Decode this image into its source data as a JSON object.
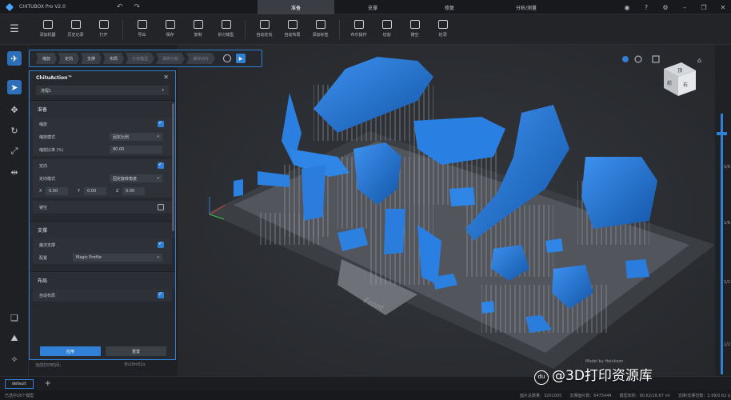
{
  "app": {
    "title": "CHITUBOX Pro V2.0"
  },
  "top_tabs": [
    {
      "label": "准备",
      "active": true
    },
    {
      "label": "支撑",
      "active": false
    },
    {
      "label": "修复",
      "active": false
    },
    {
      "label": "分析/测量",
      "active": false
    }
  ],
  "toolbar": {
    "items": [
      {
        "label": "添加机器",
        "icon": "add-machine-icon"
      },
      {
        "label": "历史记录",
        "icon": "history-icon"
      },
      {
        "label": "打开",
        "icon": "folder-open-icon"
      },
      {
        "label": "导出",
        "icon": "export-icon"
      },
      {
        "label": "保存",
        "icon": "save-icon"
      },
      {
        "label": "复制",
        "icon": "copy-icon"
      },
      {
        "label": "拆分模型",
        "icon": "split-model-icon"
      },
      {
        "label": "自动定向",
        "icon": "auto-orient-icon"
      },
      {
        "label": "自动布局",
        "icon": "auto-layout-icon"
      },
      {
        "label": "添加标签",
        "icon": "add-tag-icon"
      },
      {
        "label": "布尔操作",
        "icon": "boolean-icon"
      },
      {
        "label": "切割",
        "icon": "cut-icon"
      },
      {
        "label": "镂空",
        "icon": "hollow-icon"
      },
      {
        "label": "挖洞",
        "icon": "drill-hole-icon"
      }
    ]
  },
  "workflow": {
    "steps": [
      {
        "label": "缩放",
        "dim": false
      },
      {
        "label": "定向",
        "dim": false
      },
      {
        "label": "支撑",
        "dim": false
      },
      {
        "label": "布局",
        "dim": false
      },
      {
        "label": "分组模型",
        "dim": true
      },
      {
        "label": "保存分割",
        "dim": true
      },
      {
        "label": "保存切片",
        "dim": true
      }
    ]
  },
  "panel": {
    "title": "ChituAction™",
    "preset": "流程1",
    "sections": {
      "prepare": {
        "title": "准备",
        "scale_label": "缩放",
        "scale_mode_label": "缩放模式",
        "scale_mode_value": "固定比例",
        "scale_ratio_label": "缩放比率 (%)",
        "scale_ratio_value": "80.00",
        "orient_label": "定向",
        "orient_mode_label": "定向模式",
        "orient_mode_value": "固定旋转角度",
        "x_label": "X",
        "x_value": "0.00",
        "y_label": "Y",
        "y_value": "0.00",
        "z_label": "Z",
        "z_value": "0.00",
        "hollow_label": "镂空"
      },
      "support": {
        "title": "支撑",
        "magic_support_label": "魔法支撑",
        "config_label": "配置",
        "config_value": "Magic Profile"
      },
      "layout": {
        "title": "布局",
        "auto_layout_label": "自动布局"
      }
    },
    "apply_label": "应用",
    "reset_label": "重置"
  },
  "print_time": {
    "label": "当前打印时间：",
    "value": "3h10m51s"
  },
  "plate_label": "Front",
  "model_credit": "Model by Heinkson",
  "right_slider": {
    "level": 0.93,
    "ticks": [
      "5/6",
      "1/6",
      "1/2",
      "1/2"
    ]
  },
  "plate_tabs": [
    "default"
  ],
  "status": {
    "left": "已选中18个模型",
    "items": [
      "面片总数量：3201005",
      "支撑面片数：6475444",
      "模型体积：90.62/18.67 ml",
      "支撑/支撑份数：2.99/0.62 $"
    ]
  },
  "watermark": "@3D打印资源库",
  "watermark_badge": "du",
  "colors": {
    "accent": "#2f80d6",
    "model": "#1f74d8",
    "support": "#8d9198",
    "plate": "#5a5d63"
  }
}
